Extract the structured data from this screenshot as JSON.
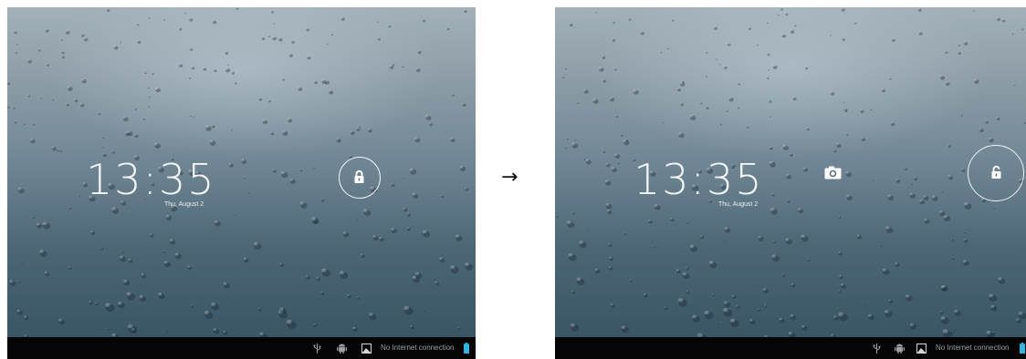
{
  "transition_arrow": "→",
  "screens": {
    "before": {
      "clock": "13:35",
      "date": "Thu, August 2",
      "unlock_icon": "lock-icon",
      "status_bar": {
        "icons": [
          "usb-icon",
          "android-debug-icon",
          "picture-icon"
        ],
        "connection_text": "No Internet connection",
        "battery_icon": "battery-icon"
      }
    },
    "after": {
      "clock": "13:35",
      "date": "Thu, August 2",
      "camera_icon": "camera-icon",
      "unlock_icon": "unlock-icon",
      "status_bar": {
        "icons": [
          "usb-icon",
          "android-debug-icon",
          "picture-icon"
        ],
        "connection_text": "No Internet connection",
        "battery_icon": "battery-icon"
      }
    }
  },
  "colors": {
    "battery": "#33b5e5",
    "navbar": "#050505",
    "status_text": "#9aa0a4"
  }
}
